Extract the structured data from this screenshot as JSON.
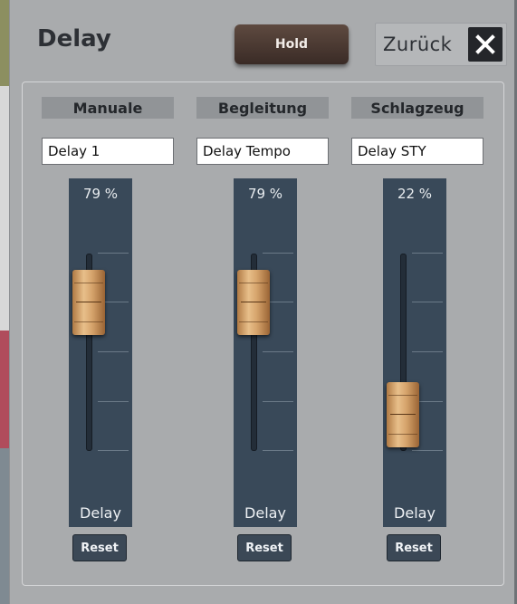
{
  "dialog": {
    "title": "Delay",
    "hold_label": "Hold",
    "back_label": "Zurück"
  },
  "channels": [
    {
      "header": "Manuale",
      "effect": "Delay 1",
      "percent_text": "79 %",
      "level": 0.79,
      "slider_label": "Delay",
      "reset_label": "Reset"
    },
    {
      "header": "Begleitung",
      "effect": "Delay Tempo",
      "percent_text": "79 %",
      "level": 0.79,
      "slider_label": "Delay",
      "reset_label": "Reset"
    },
    {
      "header": "Schlagzeug",
      "effect": "Delay STY",
      "percent_text": "22 %",
      "level": 0.22,
      "slider_label": "Delay",
      "reset_label": "Reset"
    }
  ],
  "icons": {
    "close": "close-icon"
  }
}
